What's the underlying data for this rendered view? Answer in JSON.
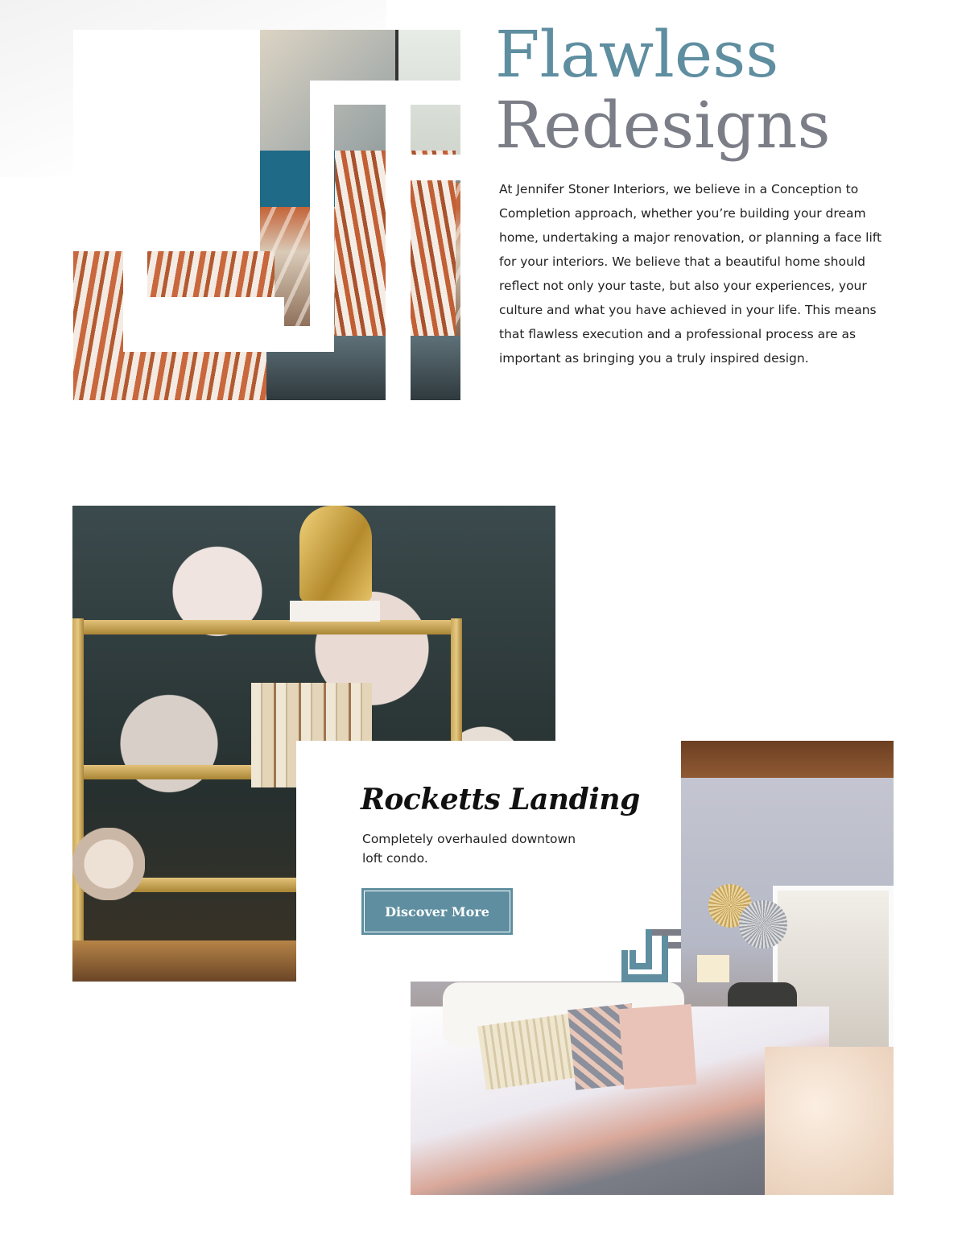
{
  "hero": {
    "title_line1": "Flawless",
    "title_line2": "Redesigns",
    "body": "At Jennifer Stoner Interiors, we believe in a Conception to Completion approach, whether you’re building your dream home, undertaking a major renovation, or planning a face lift for your interiors.  We believe that a beautiful home should reflect not only your taste, but also your experiences, your culture and what you have achieved in your life.  This means that flawless execution and a professional process are as important as bringing you a truly inspired design."
  },
  "project": {
    "title": "Rocketts Landing",
    "description": "Completely overhauled downtown loft condo.",
    "button_label": "Discover More"
  },
  "colors": {
    "accent_teal": "#5e8ea0",
    "title_gray": "#7b7d87",
    "text": "#222222",
    "logo_gray": "#7b7d87"
  },
  "icons": {
    "brand_monogram": "js-monogram-icon"
  }
}
